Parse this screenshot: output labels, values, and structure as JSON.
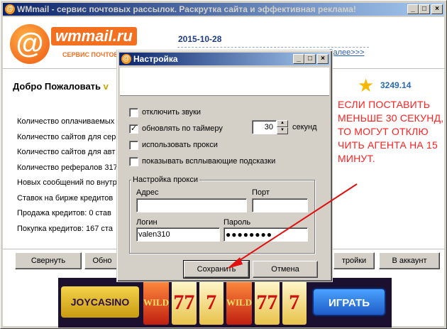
{
  "main_window": {
    "title": "WMmail - сервис почтовых рассылок. Раскрутка сайта и эффективная реклама!",
    "logo_text": "wmmail.ru",
    "logo_sub": "СЕРВИС ПОЧТОВЫХ",
    "news_date": "2015-10-28",
    "news_link": "Далее>>>",
    "welcome": "Добро Пожаловать",
    "welcome_user": "v",
    "balance": "3249.14",
    "stats": [
      "Количество оплачиваемых",
      "Количество сайтов для сер",
      "Количество сайтов для авт",
      "Количество рефералов 317",
      "Новых сообщений по внутр",
      "Ставок на бирже кредитов",
      "Продажа кредитов: 0 став",
      "Покупка кредитов: 167 ста"
    ],
    "buttons": {
      "minimize": "Свернуть",
      "refresh": "Обно",
      "settings": "тройки",
      "account": "В аккаунт"
    },
    "banner": {
      "brand": "JOYCASINO",
      "reels": [
        "WILD",
        "77",
        "7",
        "WILD",
        "77",
        "7"
      ],
      "play": "ИГРАТЬ"
    }
  },
  "annotation": {
    "text": "ЕСЛИ ПОСТАВИТЬ МЕНЬШЕ 30 СЕКУНД, ТО МОГУТ ОТКЛЮ ЧИТЬ АГЕНТА НА 15 МИНУТ.",
    "color": "#ff2020"
  },
  "settings_dialog": {
    "title": "Настройка",
    "options": [
      {
        "label": "отключить звуки",
        "checked": false
      },
      {
        "label": "обновлять по таймеру",
        "checked": true
      },
      {
        "label": "использовать прокси",
        "checked": false
      },
      {
        "label": "показывать всплывающие подсказки",
        "checked": false
      }
    ],
    "timer_value": "30",
    "timer_unit": "секунд",
    "proxy_group": {
      "title": "Настройка прокси",
      "address_label": "Адрес",
      "address_value": "",
      "port_label": "Порт",
      "port_value": "",
      "login_label": "Логин",
      "login_value": "valen310",
      "password_label": "Пароль",
      "password_value": "●●●●●●●●"
    },
    "save_label": "Сохранить",
    "cancel_label": "Отмена"
  },
  "colors": {
    "titlebar_start": "#0a246a",
    "titlebar_end": "#a6caf0",
    "brand_orange": "#f37021",
    "balance_blue": "#2a6bb0",
    "arrow_red": "#e01010"
  }
}
